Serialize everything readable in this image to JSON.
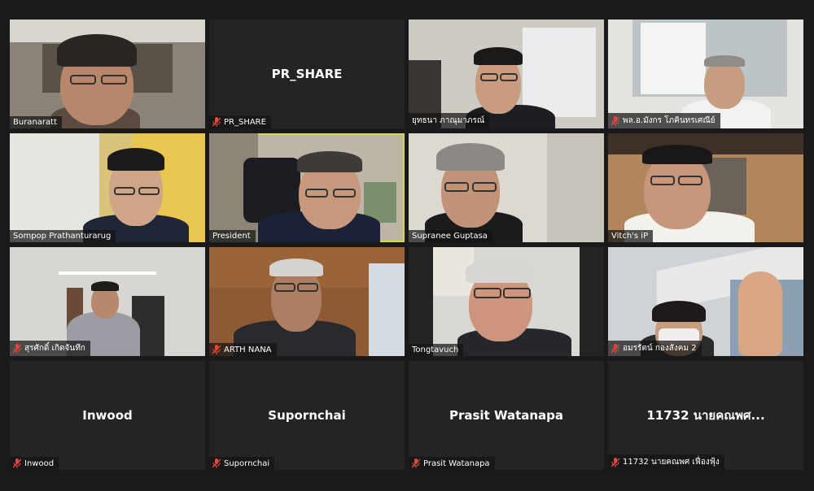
{
  "participants": [
    {
      "name": "Buranaratt",
      "label": "Buranaratt",
      "muted": false,
      "video": true
    },
    {
      "name": "PR_SHARE",
      "label": "PR_SHARE",
      "muted": true,
      "video": false
    },
    {
      "name": "ยุทธนา ภาณุมาภรณ์",
      "label": "ยุทธนา ภาณุมาภรณ์",
      "muted": false,
      "video": true
    },
    {
      "name": "พล.อ.มังกร โภคินทรเศณีย์",
      "label": "พล.อ.มังกร โภคินทรเศณีย์",
      "muted": true,
      "video": true
    },
    {
      "name": "Sompop Prathanturarug",
      "label": "Sompop Prathanturarug",
      "muted": false,
      "video": true
    },
    {
      "name": "President",
      "label": "President",
      "muted": false,
      "video": true,
      "active_speaker": true
    },
    {
      "name": "Supranee Guptasa",
      "label": "Supranee Guptasa",
      "muted": false,
      "video": true
    },
    {
      "name": "Vitch's iP",
      "label": "Vitch's iP",
      "muted": false,
      "video": true
    },
    {
      "name": "สุรศักดิ์ เกิดจันทึก",
      "label": "สุรศักดิ์ เกิดจันทึก",
      "muted": true,
      "video": true
    },
    {
      "name": "ARTH NANA",
      "label": "ARTH NANA",
      "muted": true,
      "video": true
    },
    {
      "name": "Tongtavuch",
      "label": "Tongtavuch",
      "muted": false,
      "video": true
    },
    {
      "name": "อมรรัตน์ กองสังคม 2",
      "label": "อมรรัตน์ กองสังคม 2",
      "muted": true,
      "video": true
    },
    {
      "name": "Inwood",
      "label": "Inwood",
      "muted": true,
      "video": false
    },
    {
      "name": "Supornchai",
      "label": "Supornchai",
      "muted": true,
      "video": false
    },
    {
      "name": "Prasit Watanapa",
      "label": "Prasit Watanapa",
      "muted": true,
      "video": false
    },
    {
      "name": "11732 นายคณพศ...",
      "label": "11732 นายคณพศ   เฟื่องฟุ้ง",
      "muted": true,
      "video": false
    }
  ],
  "colors": {
    "background": "#1a1a1a",
    "tile": "#242424",
    "active_border": "#d6d84a",
    "mute_icon": "#e0483e"
  },
  "icons": {
    "mute": "microphone-muted-icon"
  }
}
